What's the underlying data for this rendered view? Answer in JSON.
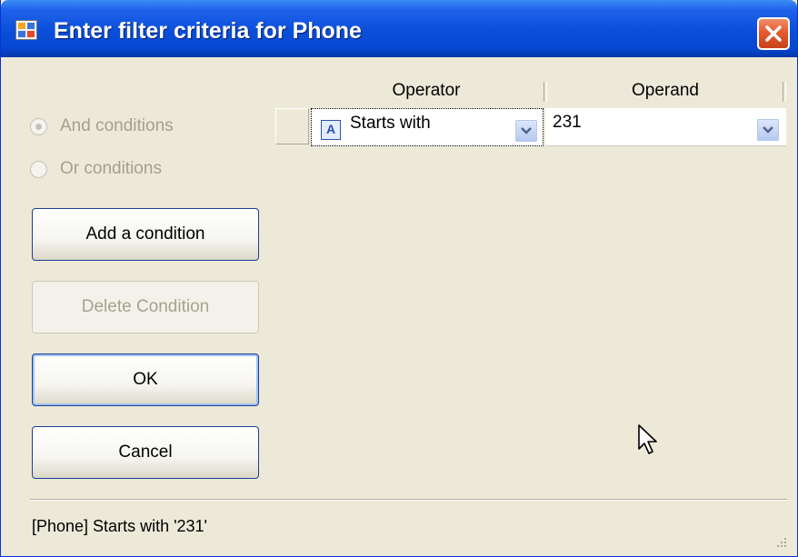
{
  "window": {
    "title": "Enter filter criteria for Phone"
  },
  "options": {
    "and_label": "And conditions",
    "or_label": "Or conditions"
  },
  "buttons": {
    "add": "Add a condition",
    "delete": "Delete Condition",
    "ok": "OK",
    "cancel": "Cancel"
  },
  "grid": {
    "columns": [
      "Operator",
      "Operand"
    ],
    "rows": [
      {
        "operator": "Starts with",
        "operand": "231"
      }
    ]
  },
  "status": {
    "text": "[Phone] Starts with '231'"
  },
  "icons": {
    "type_icon": "A"
  },
  "colors": {
    "titlebar": "#0a4fd9",
    "close": "#e55b2e",
    "background": "#ece9d8"
  }
}
